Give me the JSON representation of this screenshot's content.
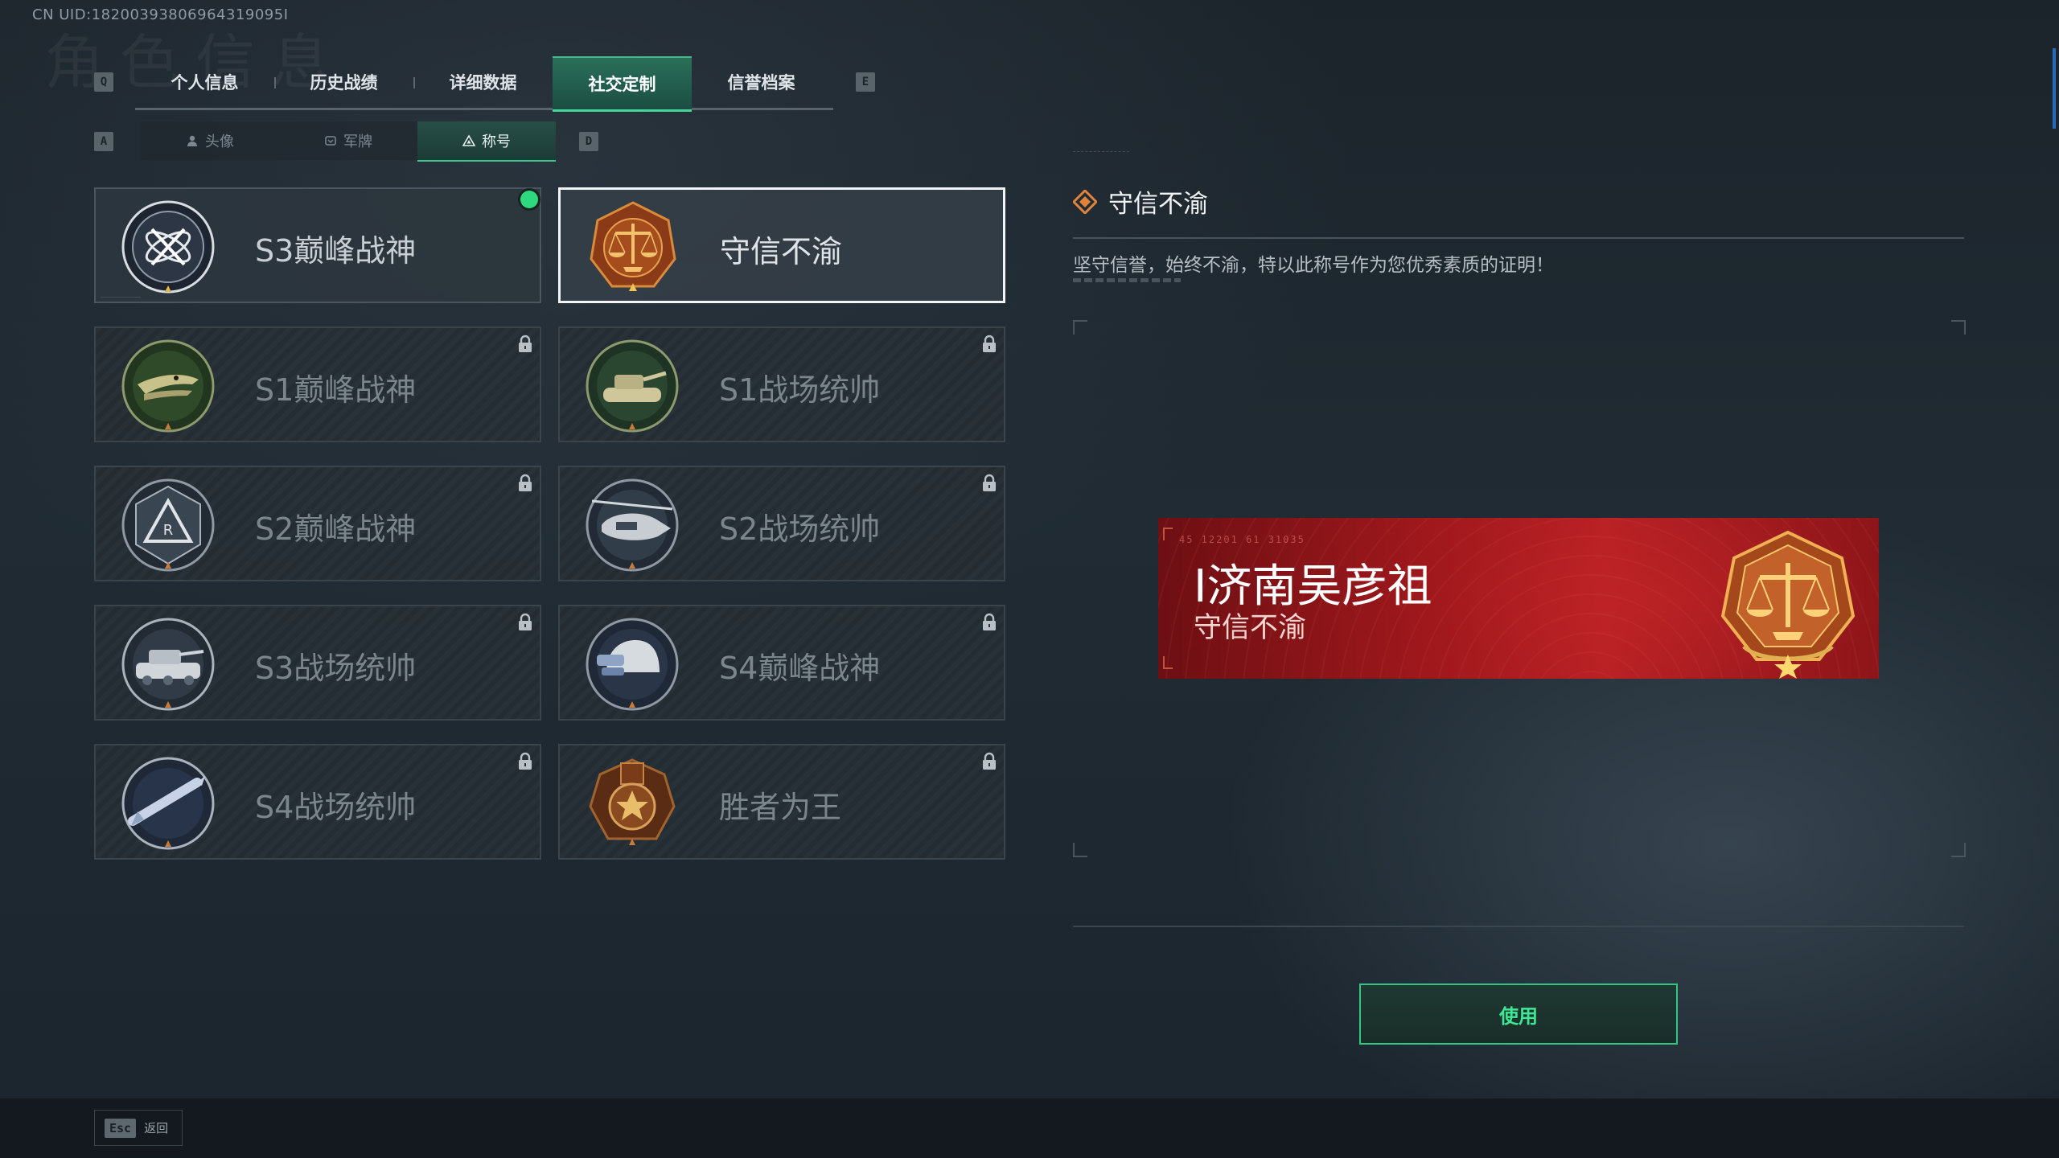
{
  "header": {
    "uid": "CN UID:18200393806964319095I",
    "watermark": "角色信息"
  },
  "main_tabs": {
    "prev_key": "Q",
    "next_key": "E",
    "items": [
      {
        "label": "个人信息",
        "active": false
      },
      {
        "label": "历史战绩",
        "active": false
      },
      {
        "label": "详细数据",
        "active": false
      },
      {
        "label": "社交定制",
        "active": true
      },
      {
        "label": "信誉档案",
        "active": false
      }
    ]
  },
  "sub_tabs": {
    "prev_key": "A",
    "next_key": "D",
    "items": [
      {
        "label": "头像",
        "icon": "person-icon",
        "active": false
      },
      {
        "label": "军牌",
        "icon": "dogtag-icon",
        "active": false
      },
      {
        "label": "称号",
        "icon": "title-icon",
        "active": true
      }
    ]
  },
  "titles": [
    {
      "label": "S3巅峰战神",
      "emblem": "s3-peak-emblem",
      "equipped": true,
      "selected": false,
      "locked": false
    },
    {
      "label": "守信不渝",
      "emblem": "scales-emblem",
      "equipped": false,
      "selected": true,
      "locked": false
    },
    {
      "label": "S1巅峰战神",
      "emblem": "crocodile-emblem",
      "equipped": false,
      "selected": false,
      "locked": true
    },
    {
      "label": "S1战场统帅",
      "emblem": "tank-emblem",
      "equipped": false,
      "selected": false,
      "locked": true
    },
    {
      "label": "S2巅峰战神",
      "emblem": "triangle-emblem",
      "equipped": false,
      "selected": false,
      "locked": true
    },
    {
      "label": "S2战场统帅",
      "emblem": "helicopter-emblem",
      "equipped": false,
      "selected": false,
      "locked": true
    },
    {
      "label": "S3战场统帅",
      "emblem": "armored-vehicle-emblem",
      "equipped": false,
      "selected": false,
      "locked": true
    },
    {
      "label": "S4巅峰战神",
      "emblem": "helmet-emblem",
      "equipped": false,
      "selected": false,
      "locked": true
    },
    {
      "label": "S4战场统帅",
      "emblem": "missile-emblem",
      "equipped": false,
      "selected": false,
      "locked": true
    },
    {
      "label": "胜者为王",
      "emblem": "medal-emblem",
      "equipped": false,
      "selected": false,
      "locked": true
    }
  ],
  "detail": {
    "title": "守信不渝",
    "description": "坚守信誉，始终不渝，特以此称号作为您优秀素质的证明！"
  },
  "banner": {
    "code": "45 12201 61 31035",
    "player_name": "I济南吴彦祖",
    "title": "守信不渝"
  },
  "actions": {
    "use_label": "使用"
  },
  "footer": {
    "esc_key": "Esc",
    "back_label": "返回"
  },
  "colors": {
    "accent": "#3ee796",
    "equipped_dot": "#2ed87e",
    "banner_red": "#b92125",
    "emblem_bronze": "#b3612a"
  }
}
